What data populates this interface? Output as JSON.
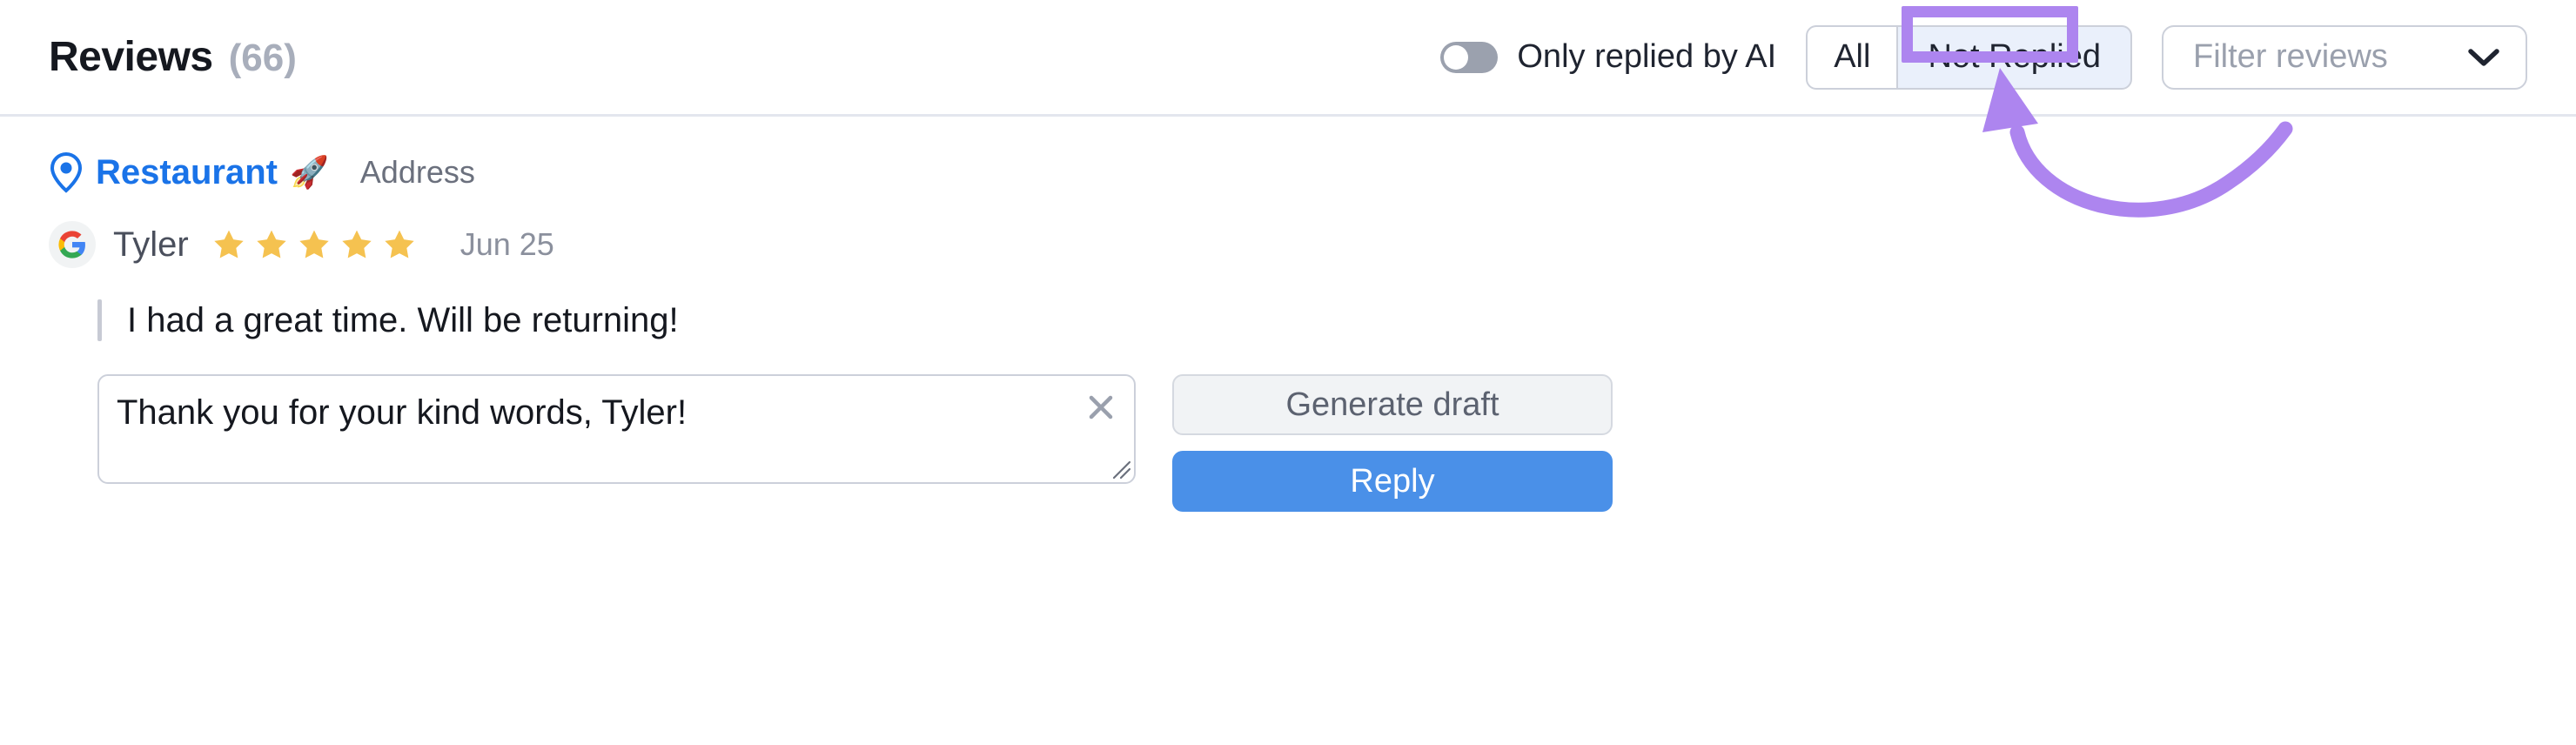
{
  "header": {
    "title": "Reviews",
    "count": "(66)",
    "ai_toggle": {
      "label": "Only replied by AI",
      "state": "off"
    },
    "segmented": {
      "options": [
        "All",
        "Not Replied"
      ],
      "selected": "Not Replied"
    },
    "filter": {
      "placeholder": "Filter reviews",
      "chevron": "chevron-down-icon"
    }
  },
  "review": {
    "place_name": "Restaurant",
    "place_emoji": "🚀",
    "address_label": "Address",
    "source": "google",
    "author": "Tyler",
    "rating": 5,
    "max_rating": 5,
    "date": "Jun 25",
    "text": "I had a great time. Will be returning!",
    "reply_draft": "Thank you for your kind words, Tyler!",
    "clear_icon": "close-icon",
    "actions": {
      "generate_label": "Generate draft",
      "reply_label": "Reply"
    }
  },
  "annotation": {
    "highlight_target": "Not Replied",
    "color": "#ad85ef",
    "arrow": "curved-arrow-up"
  },
  "colors": {
    "accent_blue": "#4a90e8",
    "link_blue": "#1a73e8",
    "star_gold": "#f5c250",
    "annotation_purple": "#ad85ef",
    "selected_segment_bg": "#eaf0fb"
  }
}
